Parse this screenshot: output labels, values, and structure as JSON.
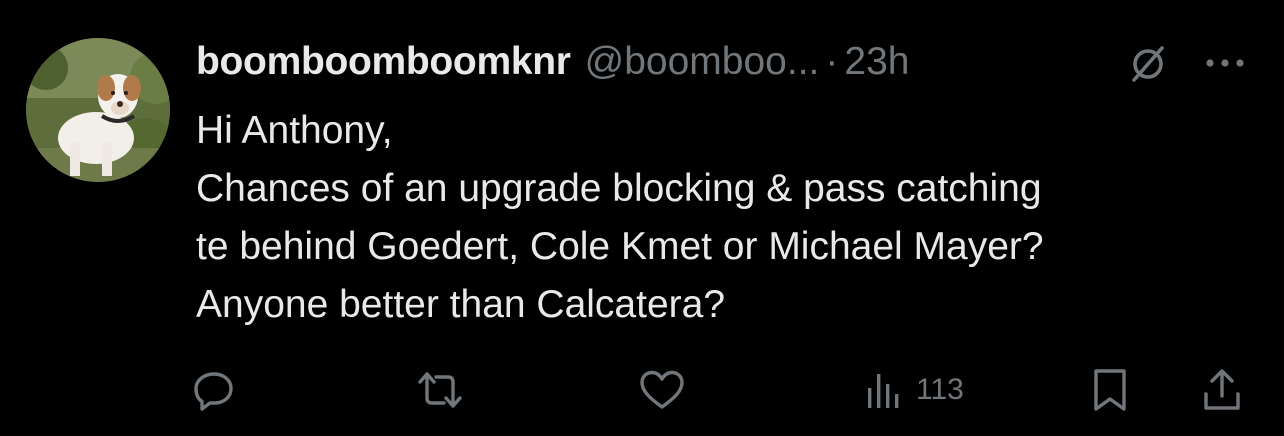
{
  "tweet": {
    "display_name": "boomboomboomknr",
    "handle": "@boomboo...",
    "separator": "·",
    "time": "23h",
    "lines": [
      "Hi Anthony,",
      "Chances of an upgrade blocking & pass catching",
      "te behind Goedert, Cole Kmet or Michael Mayer?",
      "Anyone better than Calcatera?"
    ]
  },
  "actions": {
    "reply_icon": "reply-bubble-icon",
    "retweet_icon": "retweet-icon",
    "like_icon": "heart-icon",
    "views_icon": "bar-chart-icon",
    "views_count": "113",
    "bookmark_icon": "bookmark-icon",
    "share_icon": "share-icon"
  },
  "header_icons": {
    "grok": "grok-icon",
    "more": "more-dots-icon"
  },
  "colors": {
    "background": "#000000",
    "primary_text": "#e7e9ea",
    "secondary_text": "#71767b"
  }
}
